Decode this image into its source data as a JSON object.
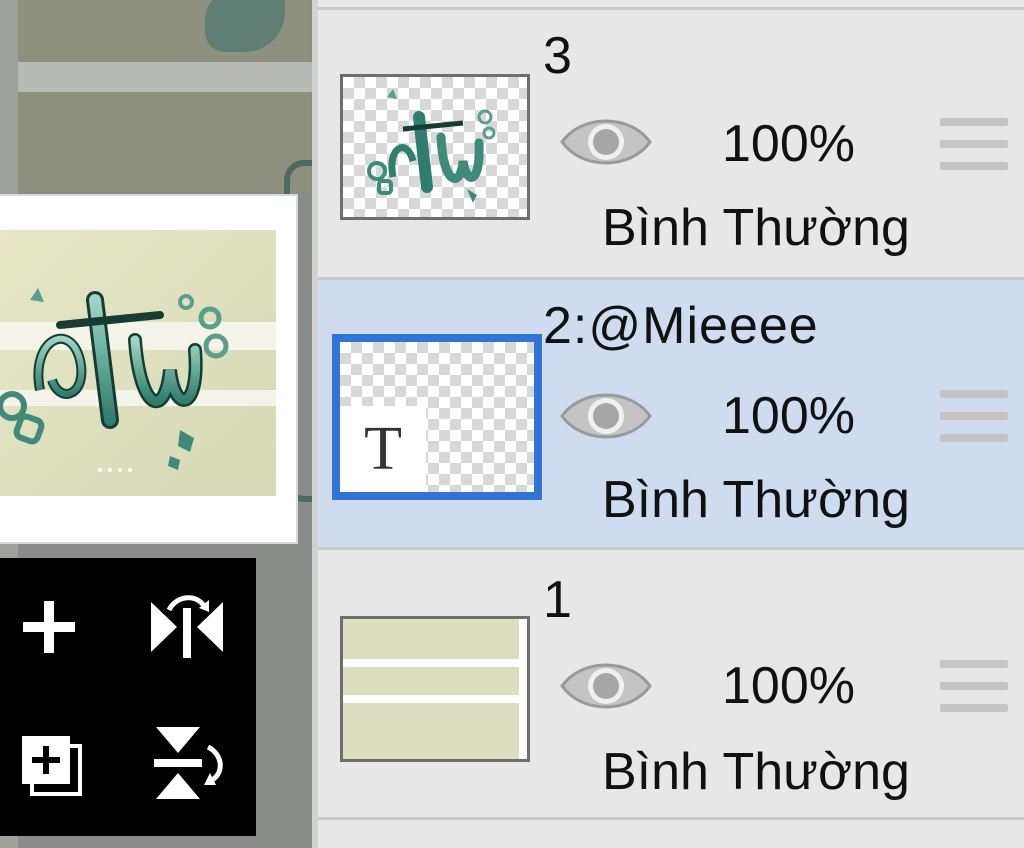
{
  "layers": [
    {
      "name": "3",
      "opacity": "100%",
      "blend_mode": "Bình Thường",
      "visible": true,
      "selected": false,
      "type": "image"
    },
    {
      "name": "2:@Mieeee",
      "opacity": "100%",
      "blend_mode": "Bình Thường",
      "visible": true,
      "selected": true,
      "type": "text",
      "type_badge": "T"
    },
    {
      "name": "1",
      "opacity": "100%",
      "blend_mode": "Bình Thường",
      "visible": true,
      "selected": false,
      "type": "image"
    }
  ],
  "tools": {
    "add_layer_icon": "plus-icon",
    "flip_horizontal_icon": "flip-horizontal-icon",
    "add_special_layer_icon": "add-layer-box-icon",
    "flip_vertical_icon": "flip-vertical-icon"
  },
  "colors": {
    "selection_border": "#2f74d6",
    "selected_row_bg": "#cfdcef",
    "panel_bg": "#e7e7e7",
    "toolbar_bg": "#000000"
  }
}
